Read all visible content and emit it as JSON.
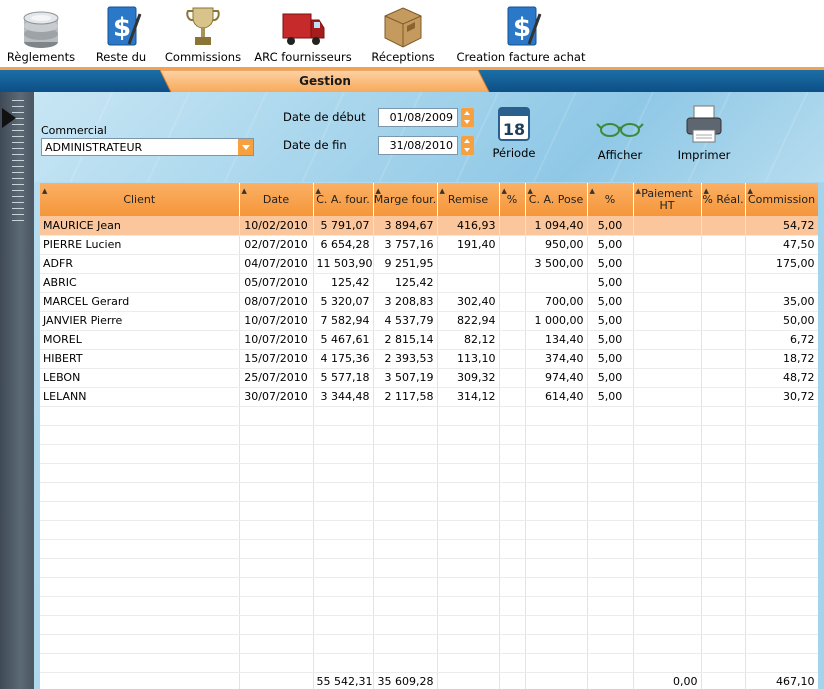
{
  "toolbar": {
    "items": [
      {
        "label": "Règlements",
        "icon": "coins-icon"
      },
      {
        "label": "Reste du",
        "icon": "dollar-document-icon"
      },
      {
        "label": "Commissions",
        "icon": "trophy-icon"
      },
      {
        "label": "ARC fournisseurs",
        "icon": "truck-icon"
      },
      {
        "label": "Réceptions",
        "icon": "package-icon"
      },
      {
        "label": "Creation facture achat",
        "icon": "dollar-document-icon"
      }
    ]
  },
  "tab": {
    "label": "Gestion"
  },
  "filters": {
    "commercial_label": "Commercial",
    "commercial_value": "ADMINISTRATEUR",
    "date_debut_label": "Date de début",
    "date_debut_value": "01/08/2009",
    "date_fin_label": "Date de fin",
    "date_fin_value": "31/08/2010",
    "calendar_day": "18",
    "periode_label": "Période",
    "afficher_label": "Afficher",
    "imprimer_label": "Imprimer"
  },
  "colors": {
    "accent": "#f5963a",
    "selected_row": "#fbc69b",
    "header_band": "#0d4f86"
  },
  "grid": {
    "columns": [
      "Client",
      "Date",
      "C. A. four.",
      "Marge four.",
      "Remise",
      "%",
      "C. A. Pose",
      "%",
      "Paiement HT",
      "% Réal.",
      "Commission"
    ],
    "rows": [
      [
        "MAURICE Jean",
        "10/02/2010",
        "5 791,07",
        "3 894,67",
        "416,93",
        "",
        "1 094,40",
        "5,00",
        "",
        "",
        "54,72"
      ],
      [
        "PIERRE Lucien",
        "02/07/2010",
        "6 654,28",
        "3 757,16",
        "191,40",
        "",
        "950,00",
        "5,00",
        "",
        "",
        "47,50"
      ],
      [
        "ADFR",
        "04/07/2010",
        "11 503,90",
        "9 251,95",
        "",
        "",
        "3 500,00",
        "5,00",
        "",
        "",
        "175,00"
      ],
      [
        "ABRIC",
        "05/07/2010",
        "125,42",
        "125,42",
        "",
        "",
        "",
        "5,00",
        "",
        "",
        ""
      ],
      [
        "MARCEL Gerard",
        "08/07/2010",
        "5 320,07",
        "3 208,83",
        "302,40",
        "",
        "700,00",
        "5,00",
        "",
        "",
        "35,00"
      ],
      [
        "JANVIER Pierre",
        "10/07/2010",
        "7 582,94",
        "4 537,79",
        "822,94",
        "",
        "1 000,00",
        "5,00",
        "",
        "",
        "50,00"
      ],
      [
        "MOREL",
        "10/07/2010",
        "5 467,61",
        "2 815,14",
        "82,12",
        "",
        "134,40",
        "5,00",
        "",
        "",
        "6,72"
      ],
      [
        "HIBERT",
        "15/07/2010",
        "4 175,36",
        "2 393,53",
        "113,10",
        "",
        "374,40",
        "5,00",
        "",
        "",
        "18,72"
      ],
      [
        "LEBON",
        "25/07/2010",
        "5 577,18",
        "3 507,19",
        "309,32",
        "",
        "974,40",
        "5,00",
        "",
        "",
        "48,72"
      ],
      [
        "LELANN",
        "30/07/2010",
        "3 344,48",
        "2 117,58",
        "314,12",
        "",
        "614,40",
        "5,00",
        "",
        "",
        "30,72"
      ]
    ],
    "totals": [
      "",
      "",
      "55 542,31",
      "35 609,28",
      "",
      "",
      "",
      "",
      "0,00",
      "",
      "467,10"
    ]
  }
}
